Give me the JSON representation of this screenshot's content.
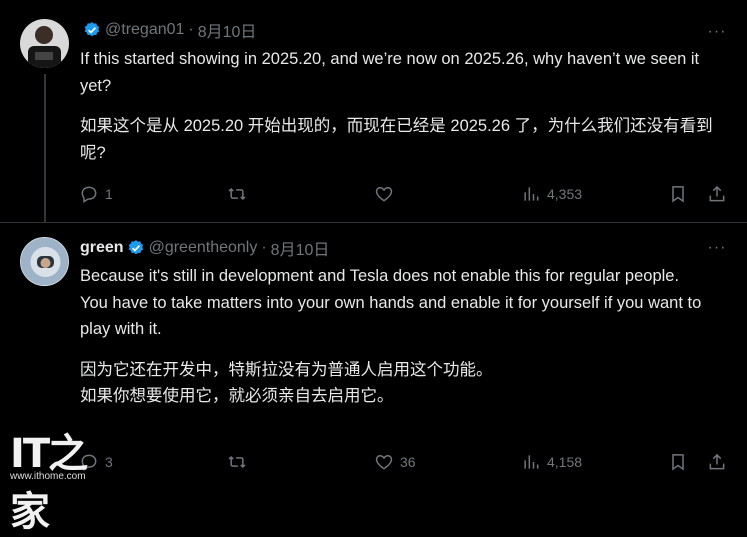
{
  "tweets": [
    {
      "display_name": "",
      "handle": "@tregan01",
      "separator": "·",
      "date": "8月10日",
      "more": "···",
      "paragraphs": [
        "If this started showing in 2025.20, and we’re now on 2025.26, why haven’t we seen it yet?",
        "如果这个是从 2025.20 开始出现的，而现在已经是 2025.26 了，为什么我们还没有看到呢?"
      ],
      "replies": "1",
      "reposts": "",
      "likes": "",
      "views": "4,353"
    },
    {
      "display_name": "green",
      "handle": "@greentheonly",
      "separator": "·",
      "date": "8月10日",
      "more": "···",
      "paragraphs": [
        "Because it's still in development and Tesla does not enable this for regular people.",
        "You have to take matters into your own hands and enable it for yourself if you want to play with it.",
        "因为它还在开发中，特斯拉没有为普通人启用这个功能。",
        "如果你想要使用它，就必须亲自去启用它。"
      ],
      "replies": "3",
      "reposts": "",
      "likes": "36",
      "views": "4,158"
    }
  ],
  "watermark": {
    "logo": "IT之家",
    "url": "www.ithome.com"
  },
  "colors": {
    "background": "#000000",
    "text": "#e7e9ea",
    "muted": "#71767b",
    "verified": "#1d9bf0"
  }
}
